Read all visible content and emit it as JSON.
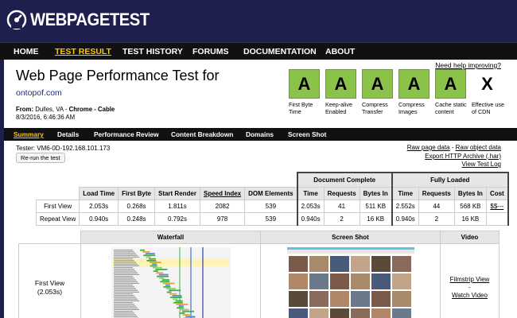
{
  "brand": {
    "name": "WEBPAGETEST"
  },
  "nav": [
    {
      "label": "HOME",
      "active": false
    },
    {
      "label": "TEST RESULT",
      "active": true
    },
    {
      "label": "TEST HISTORY",
      "active": false
    },
    {
      "label": "FORUMS",
      "active": false
    },
    {
      "label": "DOCUMENTATION",
      "active": false
    },
    {
      "label": "ABOUT",
      "active": false
    }
  ],
  "help_link": "Need help improving?",
  "title": "Web Page Performance Test for",
  "url": "ontopof.com",
  "from": {
    "label": "From:",
    "location": "Dulles, VA - ",
    "browser": "Chrome - Cable",
    "date": "8/3/2016, 6:46:36 AM"
  },
  "grades": [
    {
      "grade": "A",
      "label": "First Byte Time"
    },
    {
      "grade": "A",
      "label": "Keep-alive Enabled"
    },
    {
      "grade": "A",
      "label": "Compress Transfer"
    },
    {
      "grade": "A",
      "label": "Compress Images"
    },
    {
      "grade": "A",
      "label": "Cache static content"
    },
    {
      "grade": "X",
      "label": "Effective use of CDN"
    }
  ],
  "subnav": [
    {
      "label": "Summary",
      "active": true
    },
    {
      "label": "Details",
      "active": false
    },
    {
      "label": "Performance Review",
      "active": false
    },
    {
      "label": "Content Breakdown",
      "active": false
    },
    {
      "label": "Domains",
      "active": false
    },
    {
      "label": "Screen Shot",
      "active": false
    }
  ],
  "tester": "Tester: VM6-0D-192.168.101.173",
  "rerun_label": "Re-run the test",
  "raw": {
    "page_data": "Raw page data",
    "dash": " - ",
    "object_data": "Raw object data",
    "har": "Export HTTP Archive (.har)",
    "log": "View Test Log"
  },
  "results": {
    "doc_complete": "Document Complete",
    "fully_loaded": "Fully Loaded",
    "headers": [
      "Load Time",
      "First Byte",
      "Start Render",
      "Speed Index",
      "DOM Elements",
      "Time",
      "Requests",
      "Bytes In",
      "Time",
      "Requests",
      "Bytes In",
      "Cost"
    ],
    "rows": [
      {
        "label": "First View",
        "cells": [
          "2.053s",
          "0.268s",
          "1.811s",
          "2082",
          "539",
          "2.053s",
          "41",
          "511 KB",
          "2.552s",
          "44",
          "568 KB",
          "$$---"
        ]
      },
      {
        "label": "Repeat View",
        "cells": [
          "0.940s",
          "0.248s",
          "0.792s",
          "978",
          "539",
          "0.940s",
          "2",
          "16 KB",
          "0.940s",
          "2",
          "16 KB",
          ""
        ]
      }
    ]
  },
  "media": {
    "waterfall": "Waterfall",
    "screenshot": "Screen Shot",
    "video": "Video",
    "first_view": "First View",
    "first_view_time": "(2.053s)",
    "filmstrip": "Filmstrip View",
    "dash": "-",
    "watch": "Watch Video"
  },
  "colors": {
    "nav_bg": "#111111",
    "header_bg": "#1e1f4f",
    "accent": "#ffc600",
    "grade_green": "#8bc34a"
  }
}
